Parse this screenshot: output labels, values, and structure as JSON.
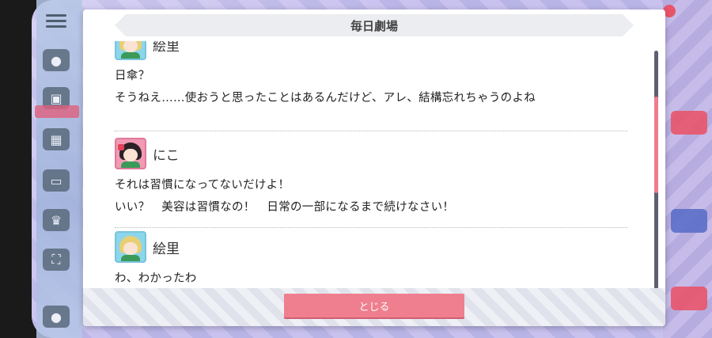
{
  "dialog": {
    "title": "毎日劇場",
    "close_label": "とじる"
  },
  "entries": [
    {
      "speaker": "絵里",
      "avatar": "eli",
      "lines": [
        "日傘？",
        "そうねえ……使おうと思ったことはあるんだけど、アレ、結構忘れちゃうのよね"
      ]
    },
    {
      "speaker": "にこ",
      "avatar": "nico",
      "lines": [
        "それは習慣になってないだけよ！",
        "いい？　美容は習慣なの！　日常の一部になるまで続けなさい！"
      ]
    },
    {
      "speaker": "絵里",
      "avatar": "eli",
      "lines": [
        "わ、わかったわ"
      ]
    }
  ],
  "colors": {
    "accent": "#ef7e8e",
    "scroll_track": "#5b6170"
  },
  "icons": [
    "menu-icon",
    "chat-icon",
    "gift-icon",
    "screen-icon",
    "crown-icon",
    "expand-icon"
  ]
}
